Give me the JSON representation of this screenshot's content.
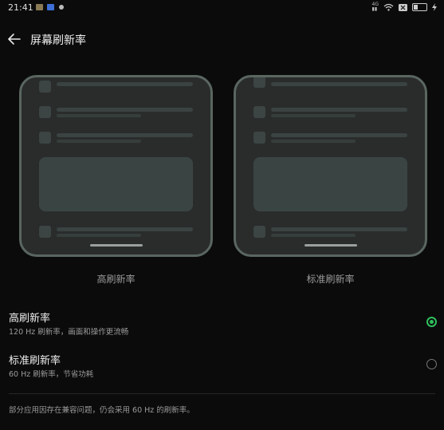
{
  "status_bar": {
    "time": "21:41",
    "network_label": "4G",
    "icons": [
      "notification-icon",
      "app-icon",
      "dot-icon",
      "wifi-icon",
      "x-icon",
      "battery-icon",
      "charging-icon"
    ],
    "accent_icon_color": "#3d6fd6"
  },
  "header": {
    "back_icon": "arrow-left-icon",
    "title": "屏幕刷新率"
  },
  "previews": [
    {
      "caption": "高刷新率"
    },
    {
      "caption": "标准刷新率"
    }
  ],
  "options": [
    {
      "name": "高刷新率",
      "description": "120 Hz 刷新率，画面和操作更流畅",
      "selected": true
    },
    {
      "name": "标准刷新率",
      "description": "60 Hz 刷新率，节省功耗",
      "selected": false
    }
  ],
  "footer_note": "部分应用因存在兼容问题，仍会采用 60 Hz 的刷新率。",
  "colors": {
    "background": "#0b0b0b",
    "selected_radio": "#2fbf5e",
    "preview_frame": "#5a6660"
  }
}
